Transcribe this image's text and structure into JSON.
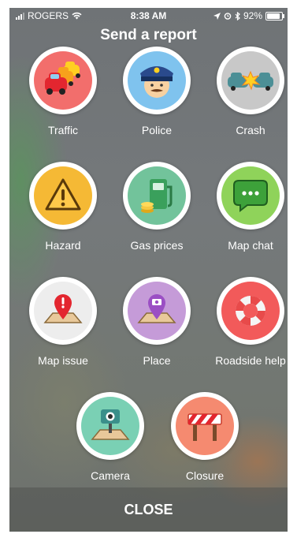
{
  "status": {
    "carrier": "ROGERS",
    "time": "8:38 AM",
    "battery": "92%"
  },
  "title": "Send a report",
  "reports": [
    {
      "label": "Traffic",
      "icon": "traffic-icon",
      "color": "#f26e6c"
    },
    {
      "label": "Police",
      "icon": "police-icon",
      "color": "#7fc3ee"
    },
    {
      "label": "Crash",
      "icon": "crash-icon",
      "color": "#c8c8c8"
    },
    {
      "label": "Hazard",
      "icon": "hazard-icon",
      "color": "#f5b935"
    },
    {
      "label": "Gas prices",
      "icon": "gas-pump-icon",
      "color": "#72c39b"
    },
    {
      "label": "Map chat",
      "icon": "chat-bubble-icon",
      "color": "#8fd35a"
    },
    {
      "label": "Map issue",
      "icon": "map-issue-icon",
      "color": "#ededed"
    },
    {
      "label": "Place",
      "icon": "place-icon",
      "color": "#c59bd8"
    },
    {
      "label": "Roadside help",
      "icon": "lifebuoy-icon",
      "color": "#f25a5a"
    },
    {
      "label": "Camera",
      "icon": "camera-icon",
      "color": "#7ad0b4"
    },
    {
      "label": "Closure",
      "icon": "road-barrier-icon",
      "color": "#f58a70"
    }
  ],
  "close_label": "CLOSE"
}
